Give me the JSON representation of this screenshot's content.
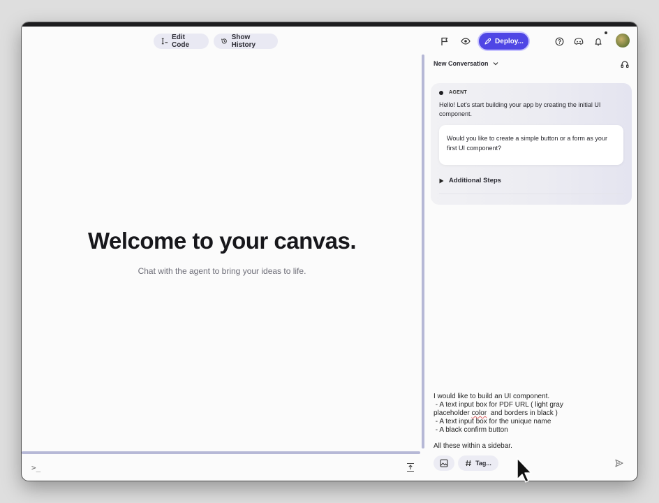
{
  "toolbar": {
    "edit_code_label": "Edit Code",
    "show_history_label": "Show History",
    "deploy_label": "Deploy..."
  },
  "canvas": {
    "title": "Welcome to your canvas.",
    "subtitle": "Chat with the agent to bring your ideas to life.",
    "terminal_prompt": ">_"
  },
  "conversation": {
    "title": "New Conversation",
    "agent_label": "AGENT",
    "agent_message": "Hello! Let's start building your app by creating the initial UI component.",
    "agent_question": "Would you like to create a simple button or a form as your first UI component?",
    "additional_steps_label": "Additional Steps"
  },
  "composer": {
    "line1": "I would like to build an UI component.",
    "line2": " - A text input box for PDF URL ( light gray",
    "line3a": "placeholder ",
    "line3b": "color",
    "line3c": "  and borders in black )",
    "line4": " - A text input box for the unique name",
    "line5": " - A black confirm button",
    "line6": "All these within a sidebar.",
    "tag_label": "Tag..."
  },
  "colors": {
    "accent": "#4f46e5",
    "splitter": "#b6b8d6"
  }
}
